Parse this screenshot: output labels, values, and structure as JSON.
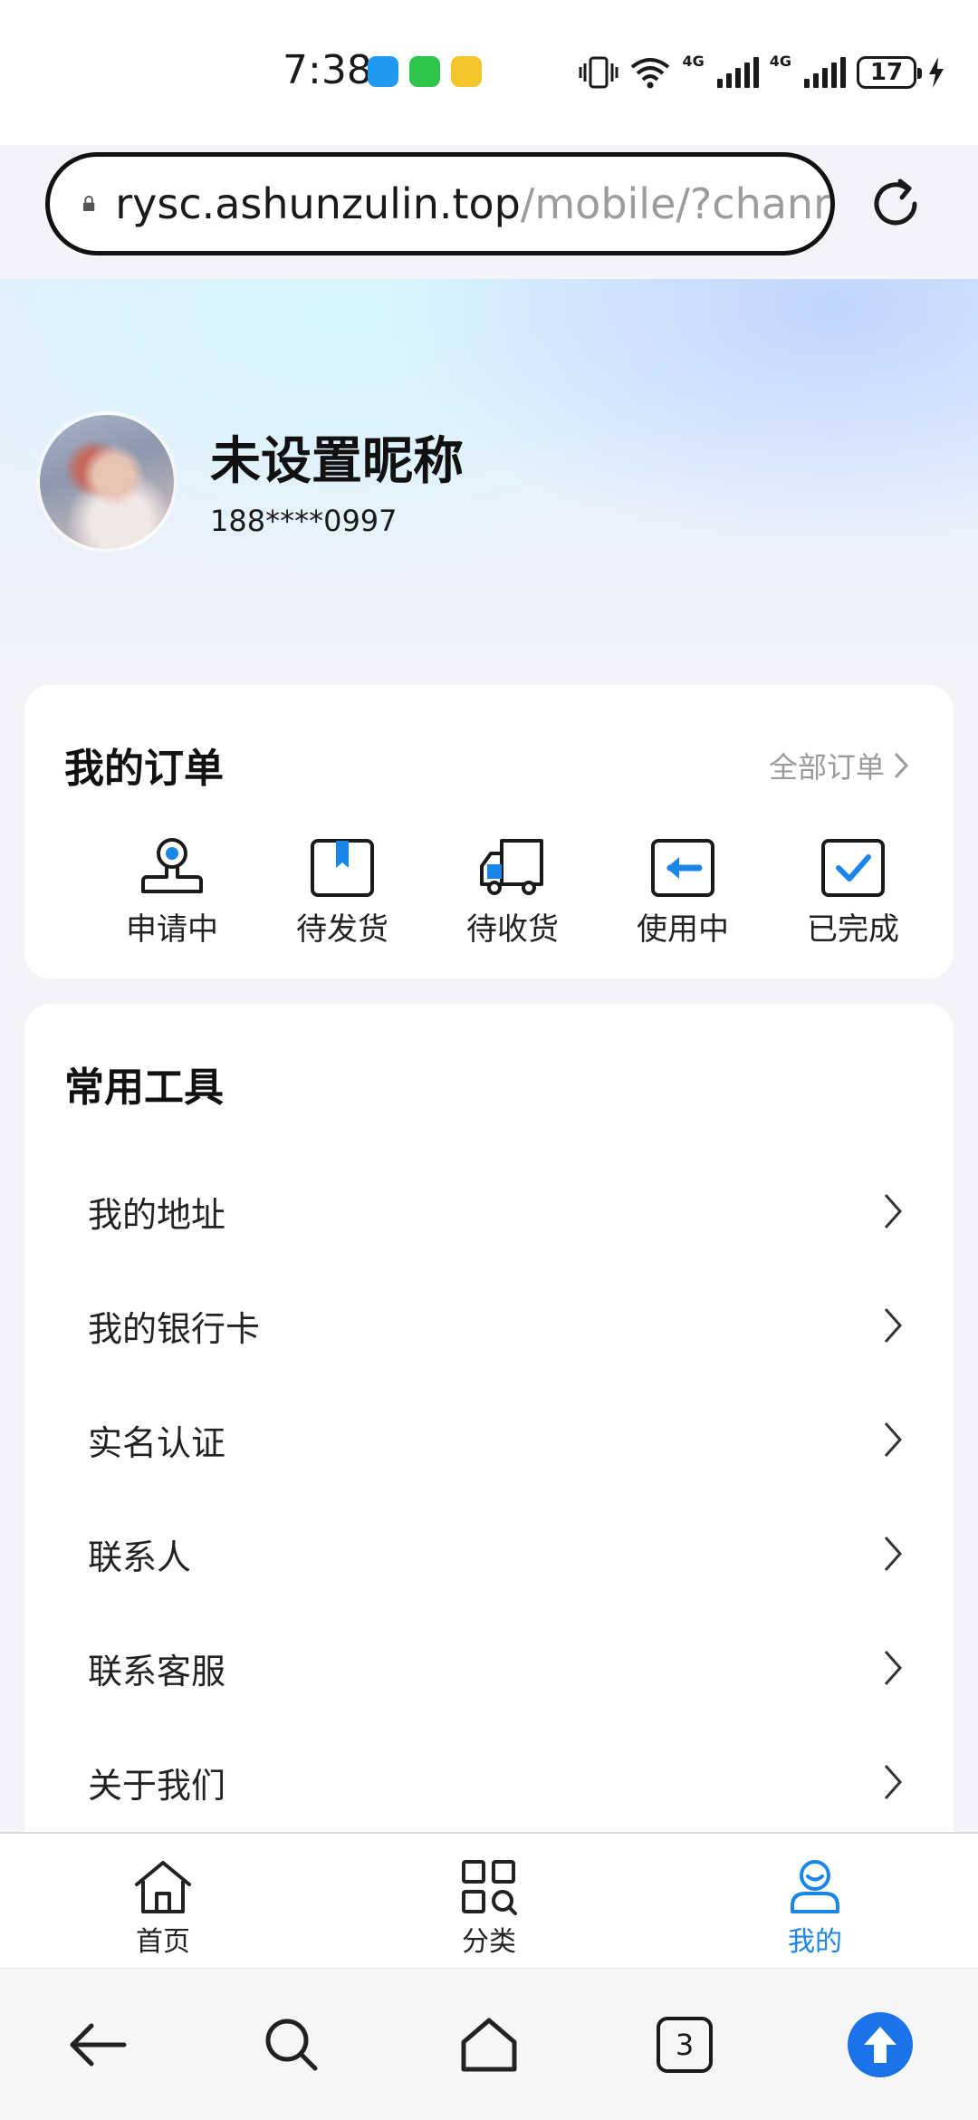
{
  "status_bar": {
    "time": "7:38",
    "network_1": "4G",
    "network_2": "4G",
    "battery": "17"
  },
  "browser": {
    "url_domain": "rysc.ashunzulin.top",
    "url_path": "/mobile/?chanr"
  },
  "profile": {
    "nickname": "未设置昵称",
    "phone": "188****0997"
  },
  "orders": {
    "title": "我的订单",
    "all_link": "全部订单",
    "items": [
      {
        "label": "申请中",
        "icon": "applying-icon"
      },
      {
        "label": "待发货",
        "icon": "bookmark-icon"
      },
      {
        "label": "待收货",
        "icon": "truck-icon"
      },
      {
        "label": "使用中",
        "icon": "in-use-icon"
      },
      {
        "label": "已完成",
        "icon": "check-icon"
      }
    ]
  },
  "tools": {
    "title": "常用工具",
    "items": [
      {
        "label": "我的地址"
      },
      {
        "label": "我的银行卡"
      },
      {
        "label": "实名认证"
      },
      {
        "label": "联系人"
      },
      {
        "label": "联系客服"
      },
      {
        "label": "关于我们"
      }
    ]
  },
  "tab_bar": {
    "items": [
      {
        "label": "首页",
        "icon": "home-icon"
      },
      {
        "label": "分类",
        "icon": "category-icon"
      },
      {
        "label": "我的",
        "icon": "profile-icon",
        "active": true
      }
    ]
  },
  "system_nav": {
    "tab_count": "3"
  },
  "colors": {
    "accent": "#1a86e8",
    "order_icon_blue": "#1a86e8"
  }
}
